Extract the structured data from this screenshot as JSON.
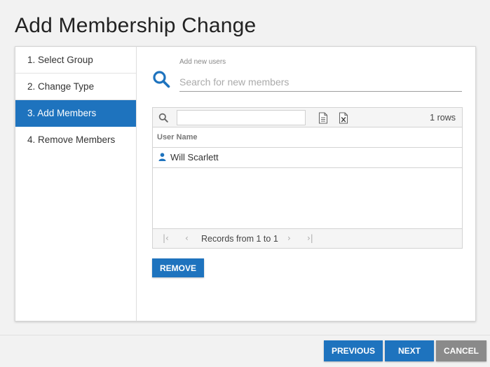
{
  "page": {
    "title": "Add Membership Change"
  },
  "steps": [
    {
      "label": "1. Select Group",
      "active": false
    },
    {
      "label": "2. Change Type",
      "active": false
    },
    {
      "label": "3. Add Members",
      "active": true
    },
    {
      "label": "4. Remove Members",
      "active": false
    }
  ],
  "search": {
    "label": "Add new users",
    "placeholder": "Search for new members",
    "value": ""
  },
  "grid": {
    "filter_value": "",
    "rows_count": "1 rows",
    "columns": [
      "User Name"
    ],
    "rows": [
      {
        "user_name": "Will Scarlett"
      }
    ],
    "pager_text": "Records from 1 to 1"
  },
  "buttons": {
    "remove": "REMOVE",
    "previous": "PREVIOUS",
    "next": "NEXT",
    "cancel": "CANCEL"
  },
  "colors": {
    "accent": "#1e73be",
    "cancel": "#8a8a8a"
  },
  "icons": {
    "search": "search-icon",
    "export_pdf": "document-icon",
    "export_excel": "excel-icon",
    "user": "user-icon"
  }
}
